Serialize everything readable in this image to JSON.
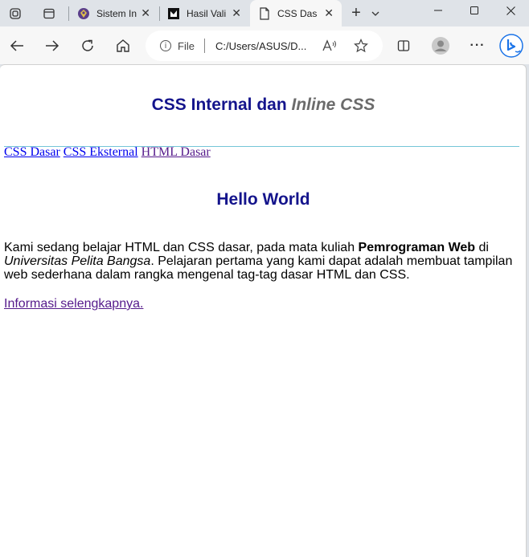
{
  "browser": {
    "tabs": [
      {
        "title": "Sistem In",
        "active": false
      },
      {
        "title": "Hasil Vali",
        "active": false
      },
      {
        "title": "CSS Dasa",
        "active": true
      }
    ],
    "address": {
      "scheme_label": "File",
      "url": "C:/Users/ASUS/D..."
    }
  },
  "page": {
    "title_main": "CSS Internal dan ",
    "title_italic": "Inline CSS",
    "nav_links": [
      {
        "label": "CSS Dasar",
        "color": "#0000ee"
      },
      {
        "label": "CSS Eksternal",
        "color": "#0000ee"
      },
      {
        "label": "HTML Dasar",
        "color": "#551a8b"
      }
    ],
    "heading": "Hello World",
    "paragraph": {
      "part1": "Kami sedang belajar HTML dan CSS dasar, pada mata kuliah ",
      "bold": "Pemrograman Web",
      "part2": " di ",
      "italic": "Universitas Pelita Bangsa",
      "part3": ". Pelajaran pertama yang kami dapat adalah membuat tampilan web sederhana dalam rangka mengenal tag-tag dasar HTML dan CSS."
    },
    "more_link": "Informasi selengkapnya."
  },
  "colors": {
    "heading": "#14148c",
    "italic_title": "#6b6b6b",
    "divider": "#74c6d7"
  }
}
